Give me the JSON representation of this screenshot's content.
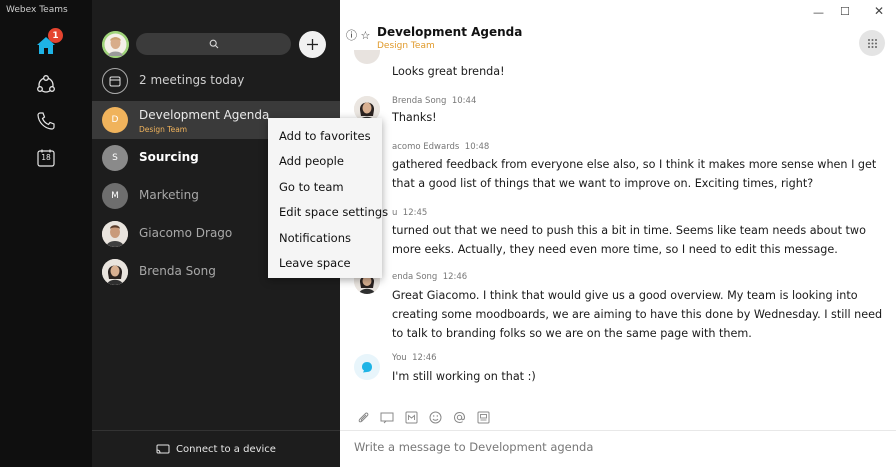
{
  "app": {
    "title": "Webex Teams"
  },
  "rail": {
    "home_badge": "1",
    "calendar_day": "18"
  },
  "spaces": {
    "meetings_label": "2 meetings today",
    "items": [
      {
        "title": "Development Agenda",
        "subtitle": "Design Team",
        "initial": "D",
        "color": "#f0b35c"
      },
      {
        "title": "Sourcing",
        "initial": "S",
        "color": "#8a8a8a"
      },
      {
        "title": "Marketing",
        "initial": "M",
        "color": "#6e6e6e"
      },
      {
        "title": "Giacomo Drago"
      },
      {
        "title": "Brenda Song"
      }
    ],
    "connect_label": "Connect to a device"
  },
  "context_menu": {
    "items": [
      "Add to favorites",
      "Add people",
      "Go to team",
      "Edit space settings",
      "Notifications",
      "Leave space"
    ]
  },
  "chat": {
    "title": "Development Agenda",
    "subtitle": "Design Team",
    "messages": [
      {
        "author": "",
        "time": "",
        "text": "Looks great brenda!"
      },
      {
        "author": "Brenda Song",
        "time": "10:44",
        "text": "Thanks!"
      },
      {
        "author": "acomo Edwards",
        "time": "10:48",
        "text": "gathered feedback from everyone else also, so I think it makes more sense when I get that a good list of things that we want to improve on. Exciting times, right?"
      },
      {
        "author": "u",
        "time": "12:45",
        "text": "turned out that we need to push this a bit in time. Seems like team needs about two more eeks. Actually, they need even more time, so I need to edit this message."
      },
      {
        "author": "enda Song",
        "time": "12:46",
        "text": "Great Giacomo. I think that would give us a good overview. My team is looking into creating some moodboards, we are aiming to have this done by Wednesday. I still need to talk to branding folks so we are on the same page with them."
      },
      {
        "author": "You",
        "time": "12:46",
        "text": "I'm still working on that :)"
      }
    ],
    "compose_placeholder": "Write a message to Development agenda"
  },
  "colors": {
    "accent": "#f0b35c",
    "badge": "#e5442f",
    "you_icon": "#1eb4e6"
  }
}
